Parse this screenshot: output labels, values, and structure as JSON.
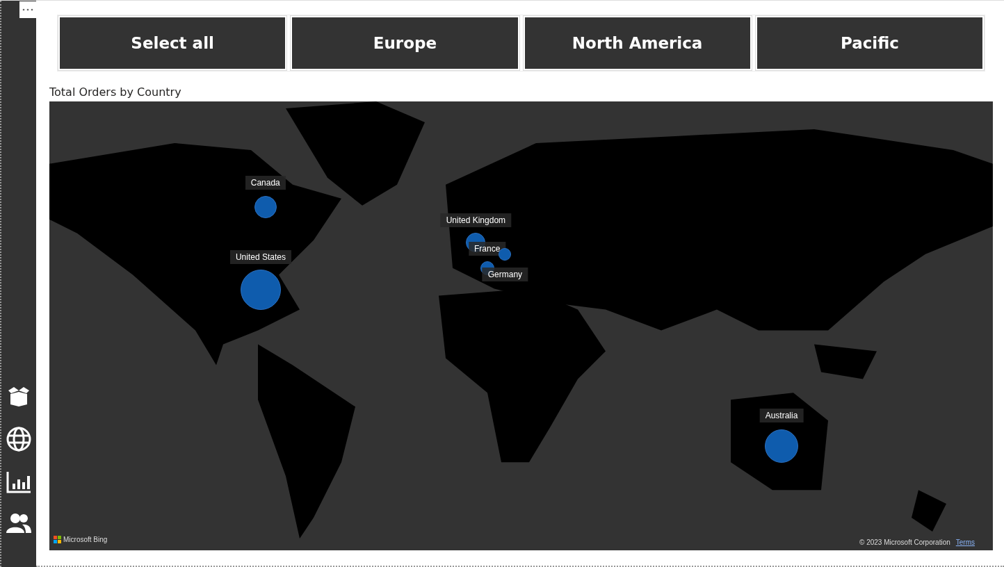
{
  "slicer": [
    {
      "label": "Select all",
      "selected": false
    },
    {
      "label": "Europe",
      "selected": false
    },
    {
      "label": "North America",
      "selected": false
    },
    {
      "label": "Pacific",
      "selected": false
    }
  ],
  "map": {
    "title": "Total Orders by Country",
    "bubbles": [
      {
        "label": "Canada"
      },
      {
        "label": "United Kingdom"
      },
      {
        "label": "France"
      },
      {
        "label": "United States"
      },
      {
        "label": "Germany"
      },
      {
        "label": "Australia"
      }
    ],
    "logo_text": "Microsoft Bing",
    "copyright": "© 2023 Microsoft Corporation",
    "terms_link": "Terms"
  }
}
